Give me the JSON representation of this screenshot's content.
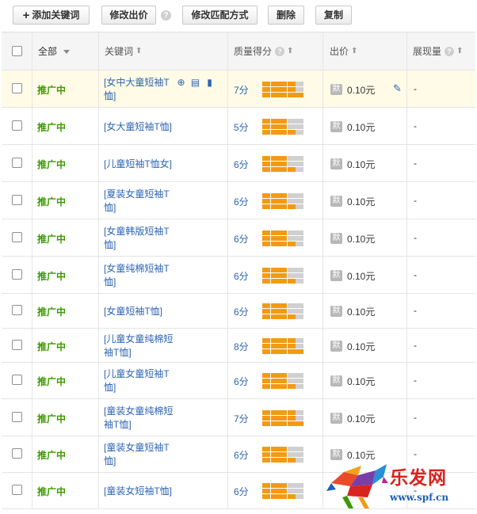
{
  "toolbar": {
    "add_keyword_label": "添加关键词",
    "edit_bid_label": "修改出价",
    "help_glyph": "?",
    "edit_match_label": "修改匹配方式",
    "delete_label": "删除",
    "copy_label": "复制"
  },
  "header": {
    "all_label": "全部",
    "keyword_label": "关键词",
    "quality_label": "质量得分",
    "bid_label": "出价",
    "impressions_label": "展现量",
    "sort_glyph": "⬆",
    "help_glyph": "?"
  },
  "rows": [
    {
      "status": "推广中",
      "keyword": "[女中大童短袖T恤]",
      "score_text": "7分",
      "score": 7,
      "mobile_badge": "默",
      "price": "0.10元",
      "impressions": "-"
    },
    {
      "status": "推广中",
      "keyword": "[女大童短袖T恤]",
      "score_text": "5分",
      "score": 5,
      "mobile_badge": "默",
      "price": "0.10元",
      "impressions": "-"
    },
    {
      "status": "推广中",
      "keyword": "[儿童短袖T恤女]",
      "score_text": "6分",
      "score": 6,
      "mobile_badge": "默",
      "price": "0.10元",
      "impressions": "-"
    },
    {
      "status": "推广中",
      "keyword": "[夏装女童短袖T恤]",
      "score_text": "6分",
      "score": 6,
      "mobile_badge": "默",
      "price": "0.10元",
      "impressions": "-"
    },
    {
      "status": "推广中",
      "keyword": "[女童韩版短袖T恤]",
      "score_text": "6分",
      "score": 6,
      "mobile_badge": "默",
      "price": "0.10元",
      "impressions": "-"
    },
    {
      "status": "推广中",
      "keyword": "[女童纯棉短袖T恤]",
      "score_text": "6分",
      "score": 6,
      "mobile_badge": "默",
      "price": "0.10元",
      "impressions": "-"
    },
    {
      "status": "推广中",
      "keyword": "[女童短袖T恤]",
      "score_text": "6分",
      "score": 6,
      "mobile_badge": "默",
      "price": "0.10元",
      "impressions": "-"
    },
    {
      "status": "推广中",
      "keyword": "[儿童女童纯棉短袖T恤]",
      "score_text": "8分",
      "score": 8,
      "mobile_badge": "默",
      "price": "0.10元",
      "impressions": "-"
    },
    {
      "status": "推广中",
      "keyword": "[儿童女童短袖T恤]",
      "score_text": "6分",
      "score": 6,
      "mobile_badge": "默",
      "price": "0.10元",
      "impressions": "-"
    },
    {
      "status": "推广中",
      "keyword": "[童装女童纯棉短袖T恤]",
      "score_text": "7分",
      "score": 7,
      "mobile_badge": "默",
      "price": "0.10元",
      "impressions": "-"
    },
    {
      "status": "推广中",
      "keyword": "[童装女童短袖T恤]",
      "score_text": "6分",
      "score": 6,
      "mobile_badge": "默",
      "price": "0.10元",
      "impressions": "-"
    },
    {
      "status": "推广中",
      "keyword": "[童装女短袖T恤]",
      "score_text": "6分",
      "score": 6,
      "mobile_badge": "",
      "price": "",
      "impressions": "-"
    }
  ],
  "watermark": {
    "title": "乐发网",
    "url": "www.spf.cn"
  },
  "colors": {
    "status_green": "#3c9a00",
    "link_blue": "#2d64b3",
    "score_orange": "#f39a13",
    "score_empty": "#d0d0d0",
    "selected_row": "#fffbe6"
  }
}
